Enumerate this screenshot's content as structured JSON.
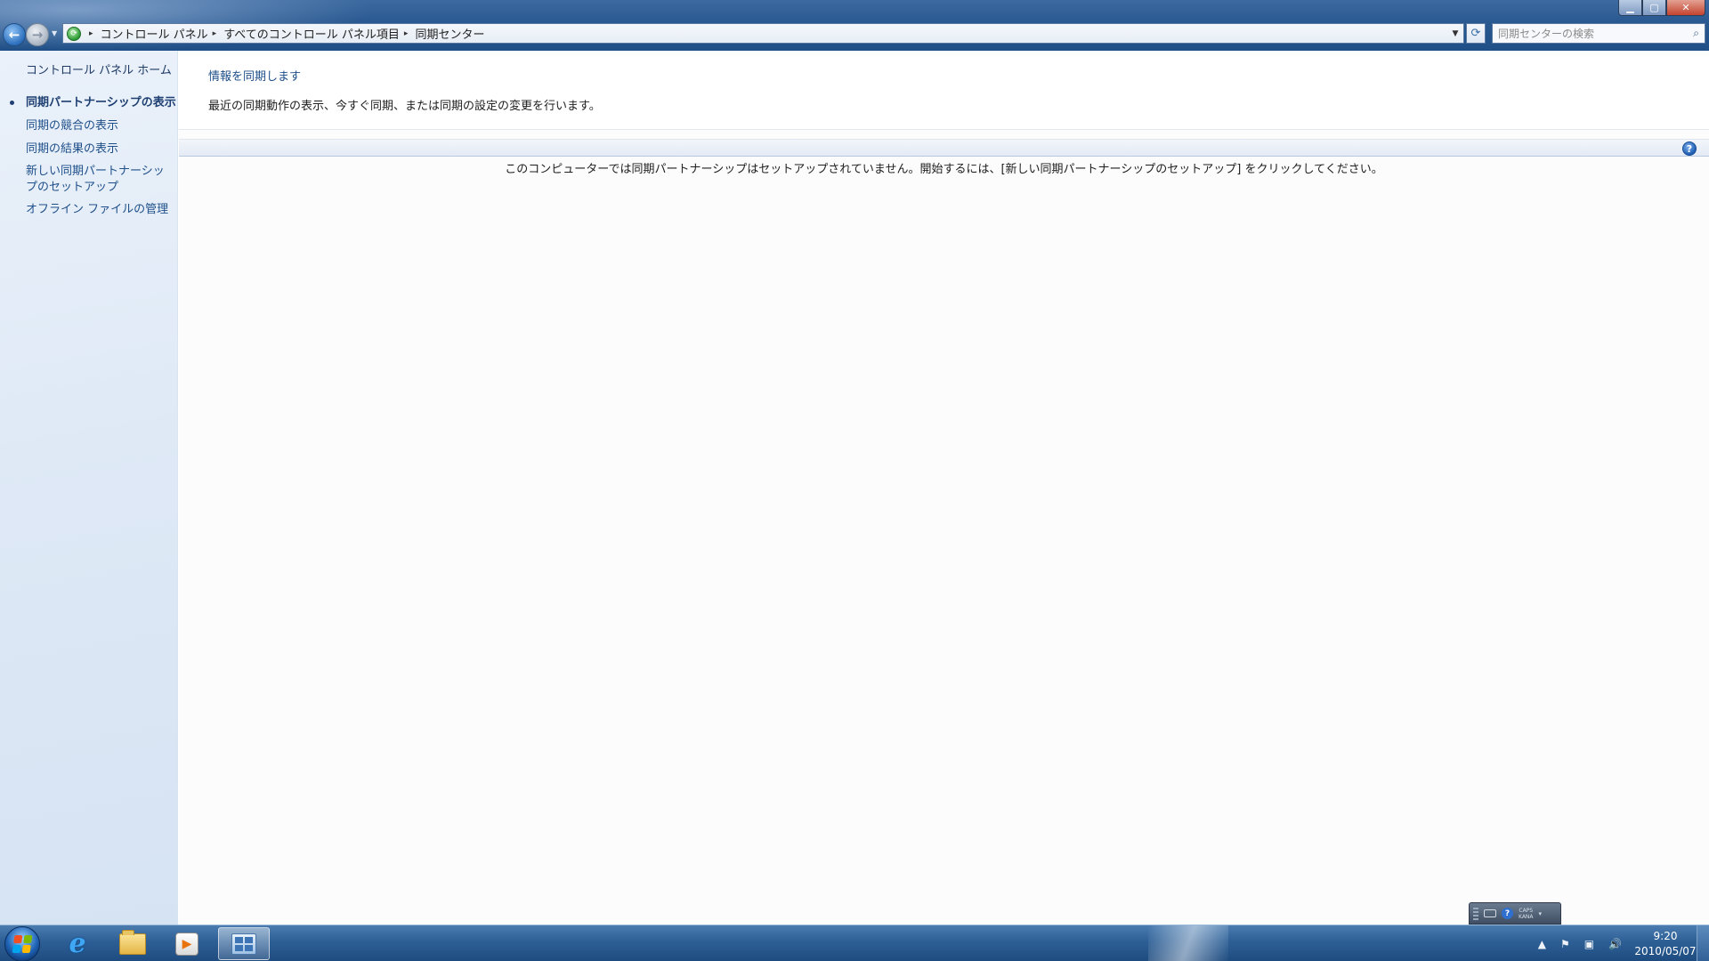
{
  "window": {
    "controls": {
      "minimize": "▁",
      "maximize": "▢",
      "close": "✕"
    }
  },
  "nav": {
    "back": "←",
    "forward": "→",
    "history": "▼"
  },
  "address": {
    "breadcrumbs": [
      "コントロール パネル",
      "すべてのコントロール パネル項目",
      "同期センター"
    ],
    "separator": "▸",
    "dropdown": "▼",
    "refresh": "⟳"
  },
  "search": {
    "placeholder": "同期センターの検索",
    "icon": "⌕"
  },
  "sidebar": {
    "home": "コントロール パネル ホーム",
    "items": [
      {
        "label": "同期パートナーシップの表示",
        "current": true
      },
      {
        "label": "同期の競合の表示"
      },
      {
        "label": "同期の結果の表示"
      },
      {
        "label": "新しい同期パートナーシップのセットアップ"
      },
      {
        "label": "オフライン ファイルの管理"
      }
    ]
  },
  "main": {
    "title": "情報を同期します",
    "description": "最近の同期動作の表示、今すぐ同期、または同期の設定の変更を行います。",
    "empty_message": "このコンピューターでは同期パートナーシップはセットアップされていません。開始するには、[新しい同期パートナーシップのセットアップ] をクリックしてください。",
    "help": "?"
  },
  "language_bar": {
    "help": "?",
    "caps": "CAPS",
    "kana": "KANA",
    "dropdown": "▾"
  },
  "taskbar": {
    "clock_time": "9:20",
    "clock_date": "2010/05/07",
    "tray_icons": [
      "▲",
      "⚑",
      "▣",
      "🔊"
    ]
  },
  "colors": {
    "link": "#1e4f8a",
    "taskbar": "#2d5f96",
    "sidebar": "#dfe9f6"
  }
}
